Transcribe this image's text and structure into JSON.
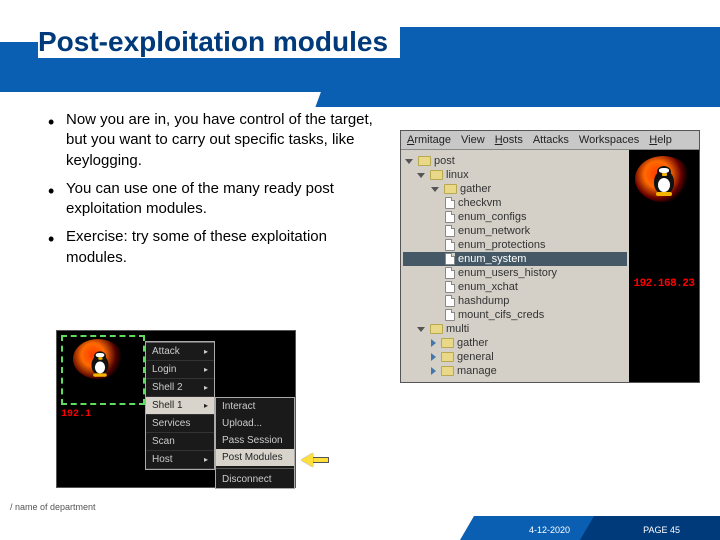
{
  "slide": {
    "title": "Post-exploitation modules",
    "bullets": [
      "Now you are in, you have control of the target, but you want to carry out specific tasks, like keylogging.",
      "You can use one of the many ready post exploitation modules.",
      "Exercise: try some of these exploitation modules."
    ]
  },
  "armitage": {
    "menu": [
      "Armitage",
      "View",
      "Hosts",
      "Attacks",
      "Workspaces",
      "Help"
    ],
    "tree": {
      "root": "post",
      "linux": "linux",
      "gather": "gather",
      "gather_items": [
        "checkvm",
        "enum_configs",
        "enum_network",
        "enum_protections",
        "enum_system",
        "enum_users_history",
        "enum_xchat",
        "hashdump",
        "mount_cifs_creds"
      ],
      "selected": "enum_system",
      "multi": "multi",
      "multi_items": [
        "gather",
        "general",
        "manage"
      ]
    },
    "host_ip": "192.168.23"
  },
  "context_ss": {
    "host_ip": "192.1",
    "main_menu": [
      "Attack",
      "Login",
      "Shell 2",
      "Shell 1",
      "Services",
      "Scan",
      "Host"
    ],
    "highlighted_main": "Shell 1",
    "submenu": [
      "Interact",
      "Upload...",
      "Pass Session",
      "Post Modules",
      "Disconnect"
    ],
    "highlighted_sub": "Post Modules"
  },
  "footer": {
    "left": "/ name of department",
    "date": "4-12-2020",
    "page": "PAGE 45"
  }
}
